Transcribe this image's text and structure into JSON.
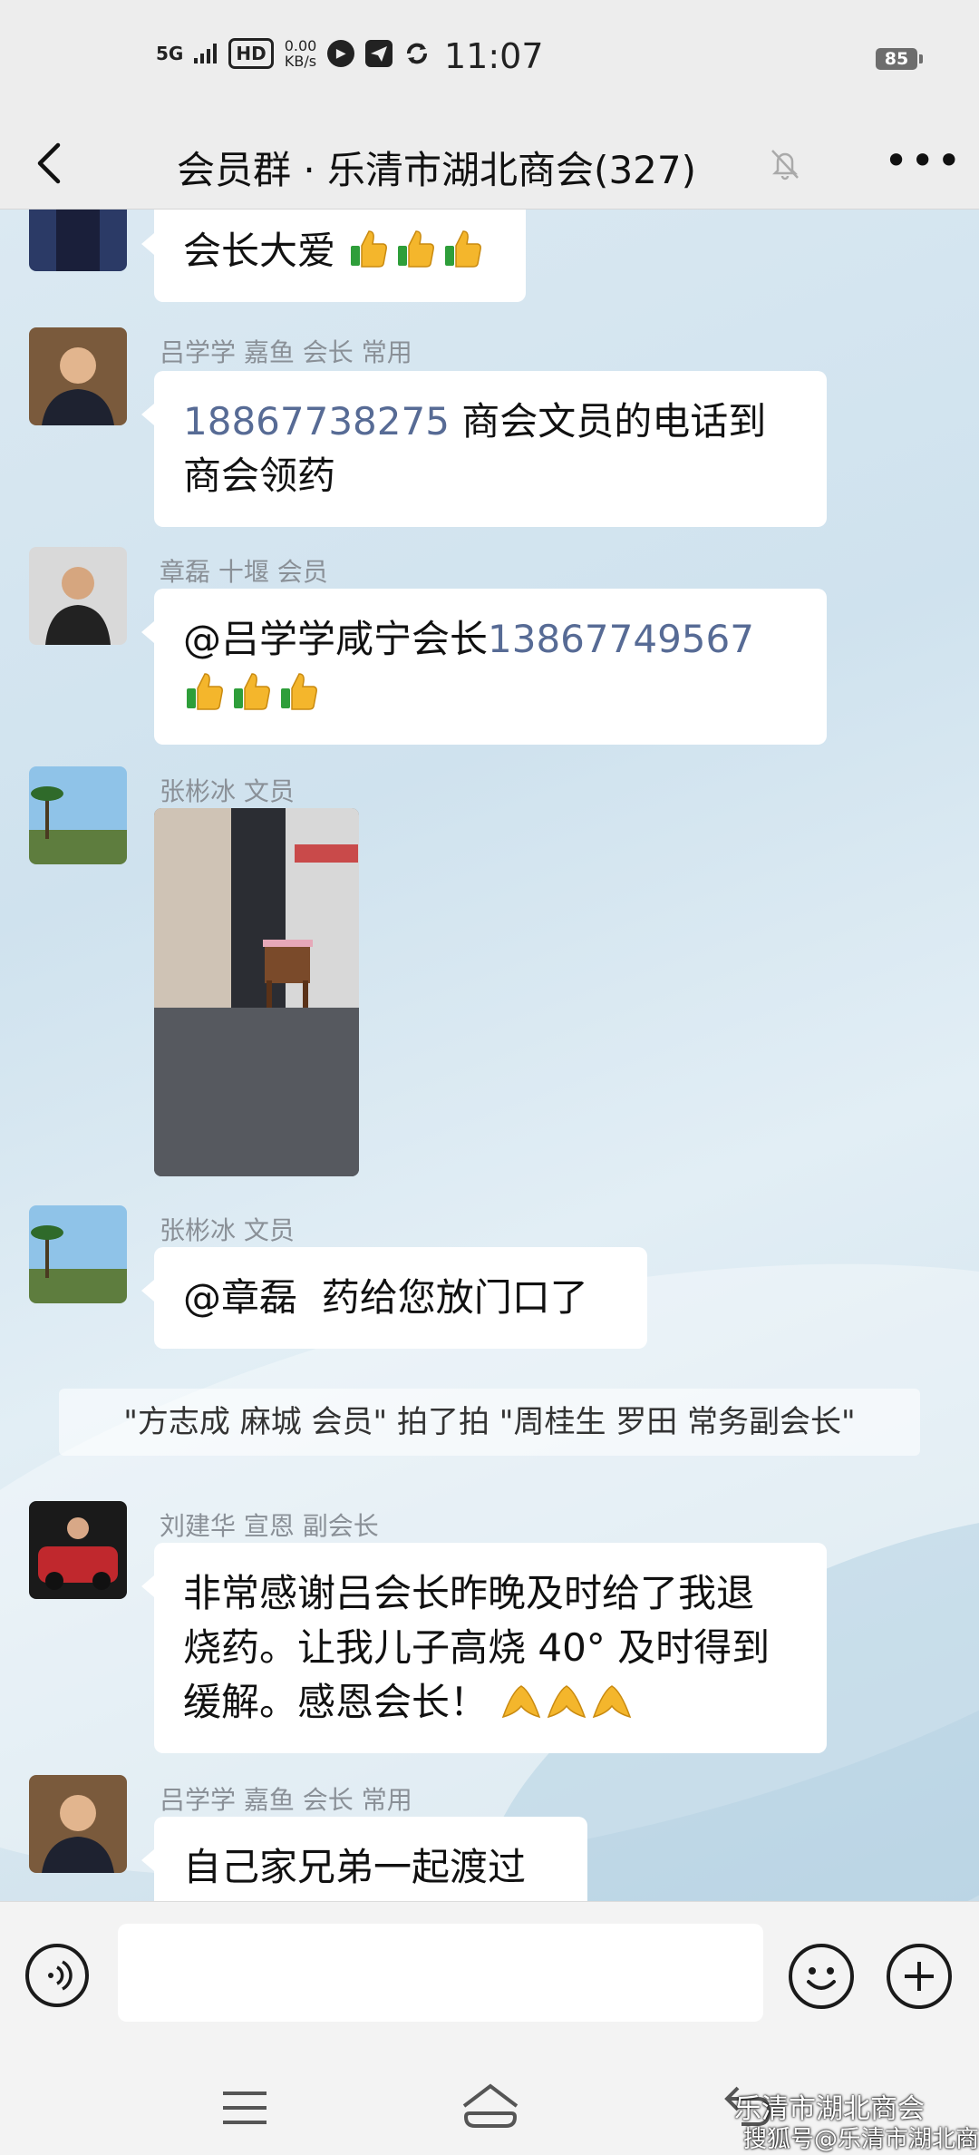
{
  "status_bar": {
    "network": "5G",
    "hd_badge": "HD",
    "speed_value": "0.00",
    "speed_unit": "KB/s",
    "time": "11:07",
    "battery": "85"
  },
  "header": {
    "title": "会员群 · 乐清市湖北商会(327)",
    "back_icon": "chevron-left-icon",
    "mute_icon": "bell-off-icon",
    "more_icon": "more-dots-icon"
  },
  "messages": [
    {
      "sender": "",
      "text": "会长大爱",
      "emoji": "thumbs-up x3"
    },
    {
      "sender": "吕学学 嘉鱼 会长 常用",
      "phone": "18867738275",
      "line1_rest": " 商会文员的电话到",
      "line2": "商会领药"
    },
    {
      "sender": "章磊 十堰 会员",
      "text_prefix": "@吕学学咸宁会长",
      "phone": "13867749567",
      "emoji": "thumbs-up x3"
    },
    {
      "sender": "张彬冰 文员",
      "type": "image"
    },
    {
      "sender": "张彬冰 文员",
      "text": "@章磊  药给您放门口了"
    },
    {
      "sender": "刘建华 宣恩 副会长",
      "line1": "非常感谢吕会长昨晚及时给了我退",
      "line2": "烧药。让我儿子高烧 40° 及时得到",
      "line3": "缓解。感恩会长！",
      "emoji": "praying-hands x3"
    },
    {
      "sender": "吕学学 嘉鱼 会长 常用",
      "text": "自己家兄弟一起渡过"
    }
  ],
  "system_message": "\"方志成 麻城 会员\" 拍了拍 \"周桂生   罗田   常务副会长\"",
  "input_bar": {
    "voice_icon": "voice-icon",
    "emoji_icon": "emoji-icon",
    "plus_icon": "plus-icon"
  },
  "watermark": {
    "line1": "乐清市湖北商会",
    "line2": "搜狐号@乐清市湖北商会"
  },
  "colors": {
    "link": "#576b95",
    "bubble": "#ffffff",
    "chrome": "#ededed"
  }
}
